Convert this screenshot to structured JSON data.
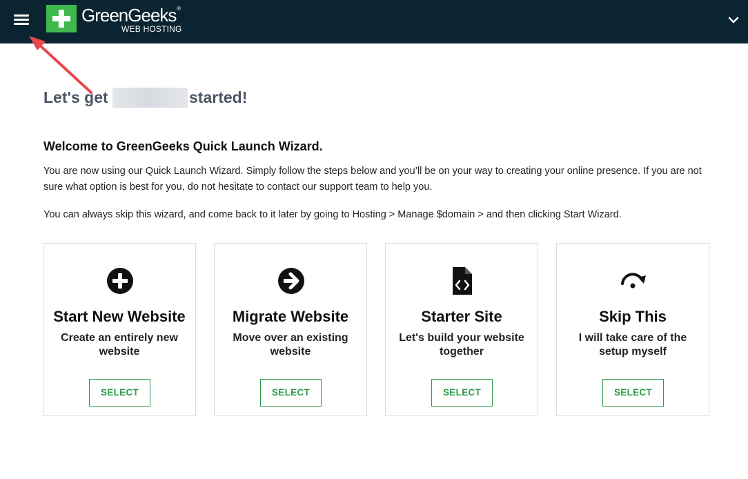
{
  "header": {
    "logo_name": "GreenGeeks",
    "logo_reg": "®",
    "logo_sub": "WEB HOSTING",
    "icons": [
      "hamburger-menu-icon",
      "chevron-down-icon"
    ],
    "background_color": "#0b2431",
    "brand_green": "#3fb94d"
  },
  "page": {
    "title_start": "Let's get",
    "title_end": "started!",
    "welcome_heading": "Welcome to GreenGeeks Quick Launch Wizard.",
    "intro_text": "You are now using our Quick Launch Wizard. Simply follow the steps below and you’ll be on your way to creating your online presence. If you are not sure what option is best for you, do not hesitate to contact our support team to help you.",
    "skip_text": "You can always skip this wizard, and come back to it later by going to Hosting > Manage $domain > and then clicking Start Wizard."
  },
  "cards": [
    {
      "icon": "plus-circle-icon",
      "title": "Start New Website",
      "description": "Create an entirely new website",
      "button": "SELECT"
    },
    {
      "icon": "arrow-circle-right-icon",
      "title": "Migrate Website",
      "description": "Move over an existing website",
      "button": "SELECT"
    },
    {
      "icon": "code-file-icon",
      "title": "Starter Site",
      "description": "Let's build your website together",
      "button": "SELECT"
    },
    {
      "icon": "skip-redo-icon",
      "title": "Skip This",
      "description": "I will take care of the setup myself",
      "button": "SELECT"
    }
  ],
  "colors": {
    "button_green": "#2e9b48",
    "title_gray": "#4b5563",
    "annotation_arrow": "#e8474c"
  }
}
